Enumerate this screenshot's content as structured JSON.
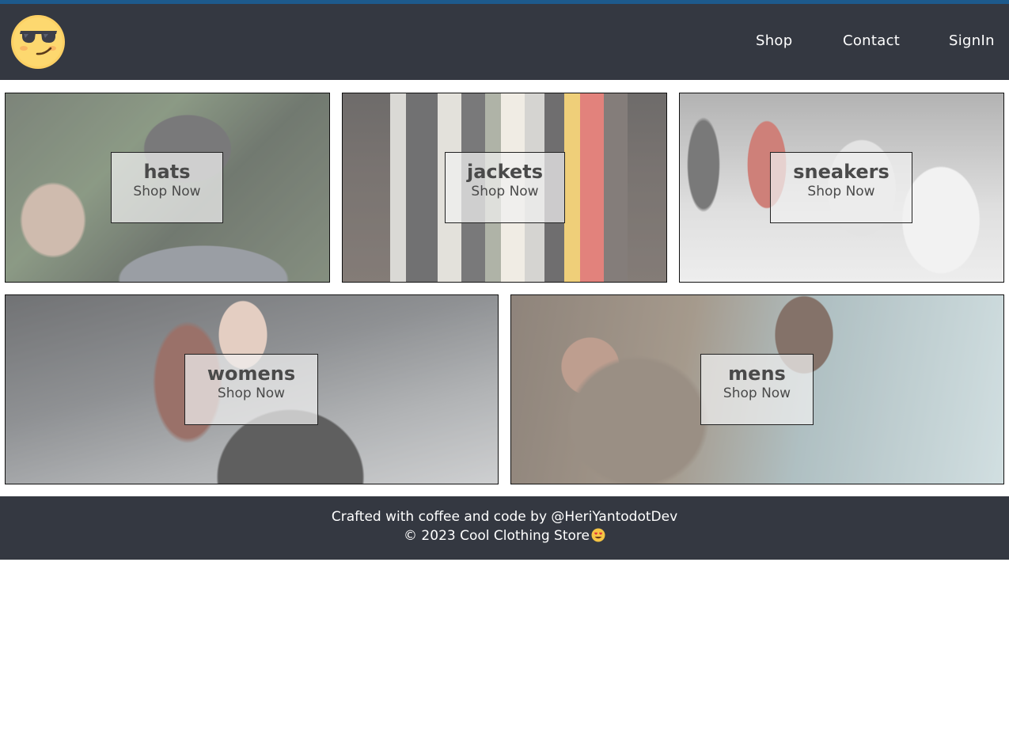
{
  "header": {
    "logo_icon": "sunglasses-emoji-icon",
    "nav": [
      {
        "label": "Shop"
      },
      {
        "label": "Contact"
      },
      {
        "label": "SignIn"
      }
    ]
  },
  "categories": [
    {
      "title": "hats",
      "cta": "Shop Now"
    },
    {
      "title": "jackets",
      "cta": "Shop Now"
    },
    {
      "title": "sneakers",
      "cta": "Shop Now"
    },
    {
      "title": "womens",
      "cta": "Shop Now"
    },
    {
      "title": "mens",
      "cta": "Shop Now"
    }
  ],
  "footer": {
    "line1": "Crafted with coffee and code by @HeriYantodotDev",
    "line2": "© 2023 Cool Clothing Store",
    "emoji_icon": "heart-eyes-emoji-icon"
  },
  "colors": {
    "navbar": "#343841",
    "topline": "#1d5a8c",
    "footer": "#343841"
  }
}
